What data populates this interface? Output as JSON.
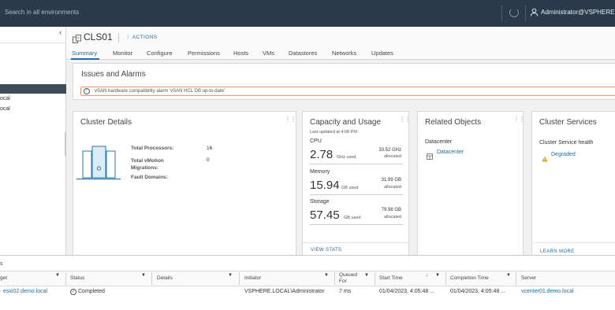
{
  "header": {
    "search_placeholder": "Search in all environments",
    "user": "Administrator@VSPHERE.L"
  },
  "nav": {
    "items": [
      "ocal",
      "ocal"
    ]
  },
  "object": {
    "title": "CLS01",
    "actions_label": "ACTIONS",
    "tabs": [
      "Summary",
      "Monitor",
      "Configure",
      "Permissions",
      "Hosts",
      "VMs",
      "Datastores",
      "Networks",
      "Updates"
    ]
  },
  "issues": {
    "title": "Issues and Alarms",
    "alarm_text": "vSAN hardware compatibility alarm 'vSAN HCL DB up-to-date'"
  },
  "cluster_details": {
    "title": "Cluster Details",
    "rows": [
      {
        "label": "Total Processors:",
        "value": "16"
      },
      {
        "label": "Total vMotion Migrations:",
        "value": "0"
      },
      {
        "label": "Fault Domains:",
        "value": ""
      }
    ]
  },
  "capacity": {
    "title": "Capacity and Usage",
    "updated": "Last updated at 4:08 PM",
    "cpu": {
      "label": "CPU",
      "used": "2.78",
      "used_unit": "GHz used",
      "alloc": "33.52 GHz",
      "alloc_label": "allocated"
    },
    "memory": {
      "label": "Memory",
      "used": "15.94",
      "used_unit": "GB used",
      "alloc": "31.99 GB",
      "alloc_label": "allocated"
    },
    "storage": {
      "label": "Storage",
      "used": "57.45",
      "used_unit": "GB used",
      "alloc": "79.98 GB",
      "alloc_label": "allocated"
    },
    "view_stats": "VIEW STATS"
  },
  "related": {
    "title": "Related Objects",
    "datacenter_label": "Datacenter",
    "datacenter_link": "Datacenter"
  },
  "services": {
    "title": "Cluster Services",
    "health_label": "Cluster Service health",
    "health_value": "Degraded",
    "learn_more": "LEARN MORE"
  },
  "tasks": {
    "pane_label": "s",
    "columns": [
      "get",
      "Status",
      "Details",
      "Initiator",
      "Queued For",
      "Start Time",
      "Completion Time",
      "Server"
    ],
    "row": {
      "target": "esxi02.demo.local",
      "status": "Completed",
      "details": "",
      "initiator": "VSPHERE.LOCAL\\Administrator",
      "queued": "7 ms",
      "start": "01/04/2023, 4:05:48 ...",
      "completion": "01/04/2023, 4:05:48 ...",
      "server": "vcenter01.demo.local"
    }
  },
  "colors": {
    "header_bg": "#2b3a4a",
    "link": "#1d6ca6",
    "alarm_border": "#e8956b",
    "warning": "#e0a21a"
  }
}
